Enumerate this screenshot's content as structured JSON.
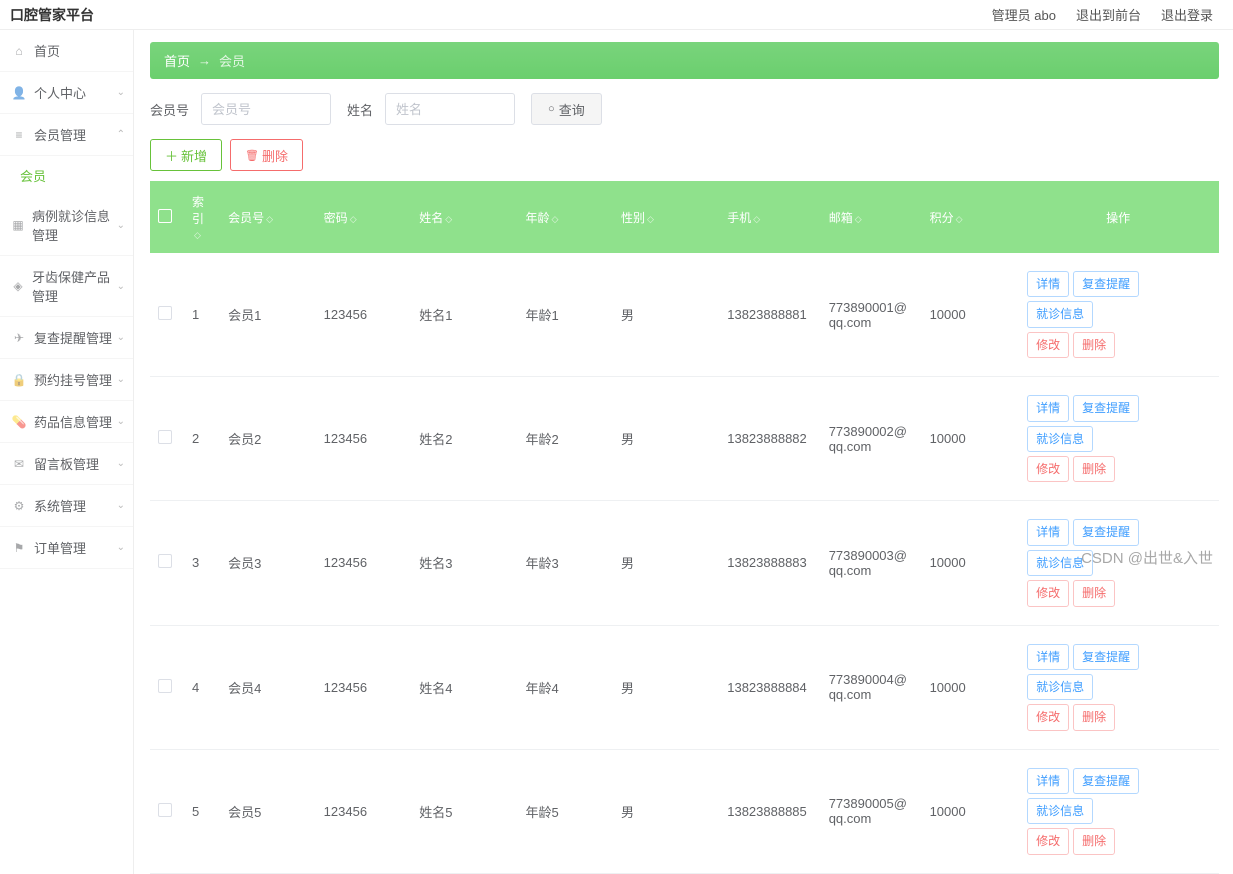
{
  "header": {
    "title": "口腔管家平台",
    "links": [
      "管理员 abo",
      "退出到前台",
      "退出登录"
    ]
  },
  "sidebar": {
    "items": [
      {
        "label": "首页",
        "icon": "home",
        "chev": ""
      },
      {
        "label": "个人中心",
        "icon": "user",
        "chev": "⌄"
      },
      {
        "label": "会员管理",
        "icon": "menu",
        "chev": "⌃",
        "active": true
      },
      {
        "label": "会员",
        "sub": true
      },
      {
        "label": "病例就诊信息管理",
        "icon": "grid",
        "chev": "⌄"
      },
      {
        "label": "牙齿保健产品管理",
        "icon": "cube",
        "chev": "⌄"
      },
      {
        "label": "复查提醒管理",
        "icon": "send",
        "chev": "⌄"
      },
      {
        "label": "预约挂号管理",
        "icon": "lock",
        "chev": "⌄"
      },
      {
        "label": "药品信息管理",
        "icon": "pill",
        "chev": "⌄"
      },
      {
        "label": "留言板管理",
        "icon": "msg",
        "chev": "⌄"
      },
      {
        "label": "系统管理",
        "icon": "gear",
        "chev": "⌄"
      },
      {
        "label": "订单管理",
        "icon": "flag",
        "chev": "⌄"
      }
    ]
  },
  "breadcrumb": {
    "home": "首页",
    "arrow": "→",
    "current": "会员"
  },
  "filters": {
    "memid_label": "会员号",
    "memid_placeholder": "会员号",
    "name_label": "姓名",
    "name_placeholder": "姓名",
    "query_icon": "○",
    "query_label": "查询"
  },
  "actions": {
    "add_icon": "＋",
    "add_label": "新增",
    "del_icon": "🗑",
    "del_label": "删除"
  },
  "table": {
    "headers": [
      "索引",
      "会员号",
      "密码",
      "姓名",
      "年龄",
      "性别",
      "手机",
      "邮箱",
      "积分",
      "操作"
    ],
    "rows": [
      {
        "idx": "1",
        "memid": "会员1",
        "pw": "123456",
        "name": "姓名1",
        "age": "年龄1",
        "sex": "男",
        "phone": "13823888881",
        "email": "773890001@qq.com",
        "points": "10000"
      },
      {
        "idx": "2",
        "memid": "会员2",
        "pw": "123456",
        "name": "姓名2",
        "age": "年龄2",
        "sex": "男",
        "phone": "13823888882",
        "email": "773890002@qq.com",
        "points": "10000"
      },
      {
        "idx": "3",
        "memid": "会员3",
        "pw": "123456",
        "name": "姓名3",
        "age": "年龄3",
        "sex": "男",
        "phone": "13823888883",
        "email": "773890003@qq.com",
        "points": "10000"
      },
      {
        "idx": "4",
        "memid": "会员4",
        "pw": "123456",
        "name": "姓名4",
        "age": "年龄4",
        "sex": "男",
        "phone": "13823888884",
        "email": "773890004@qq.com",
        "points": "10000"
      },
      {
        "idx": "5",
        "memid": "会员5",
        "pw": "123456",
        "name": "姓名5",
        "age": "年龄5",
        "sex": "男",
        "phone": "13823888885",
        "email": "773890005@qq.com",
        "points": "10000"
      }
    ],
    "ops": {
      "detail": "详情",
      "remind": "复查提醒",
      "visit": "就诊信息",
      "edit": "修改",
      "del": "删除"
    }
  },
  "watermark": "CSDN @出世&入世"
}
